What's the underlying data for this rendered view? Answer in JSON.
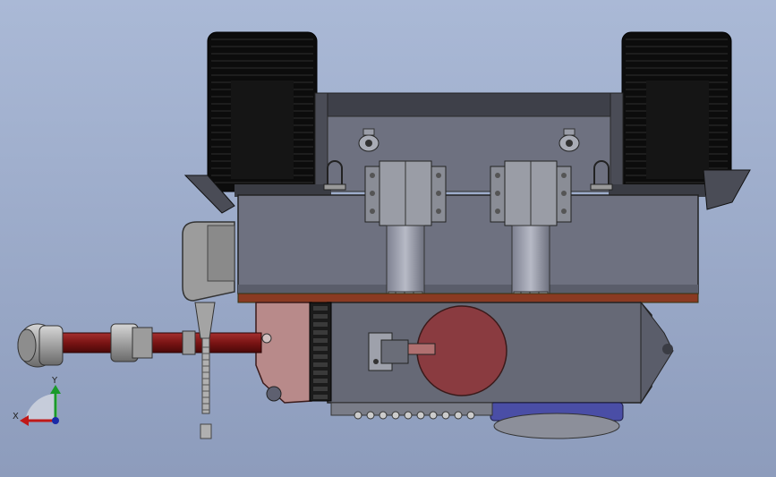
{
  "viewport": {
    "background_top": "#aab9d6",
    "background_bottom": "#8d9cbc"
  },
  "colors": {
    "frame_gray": "#6e7180",
    "frame_dark": "#3e4049",
    "track_black": "#0c0c0c",
    "track_lug": "#2b2b2b",
    "clamp_gray": "#8a8d96",
    "rod_red": "#7a1414",
    "disc_red": "#8a3b40",
    "plate_pink": "#b88a8a",
    "trim_orange": "#8a3a22",
    "blue_gear": "#4a4ea6",
    "probe_gray": "#9c9c9c"
  },
  "triad": {
    "y_label": "Y",
    "x_label": "X",
    "y_color": "#1a9a2a",
    "x_color": "#c01818",
    "z_color": "#1a2aa8"
  }
}
